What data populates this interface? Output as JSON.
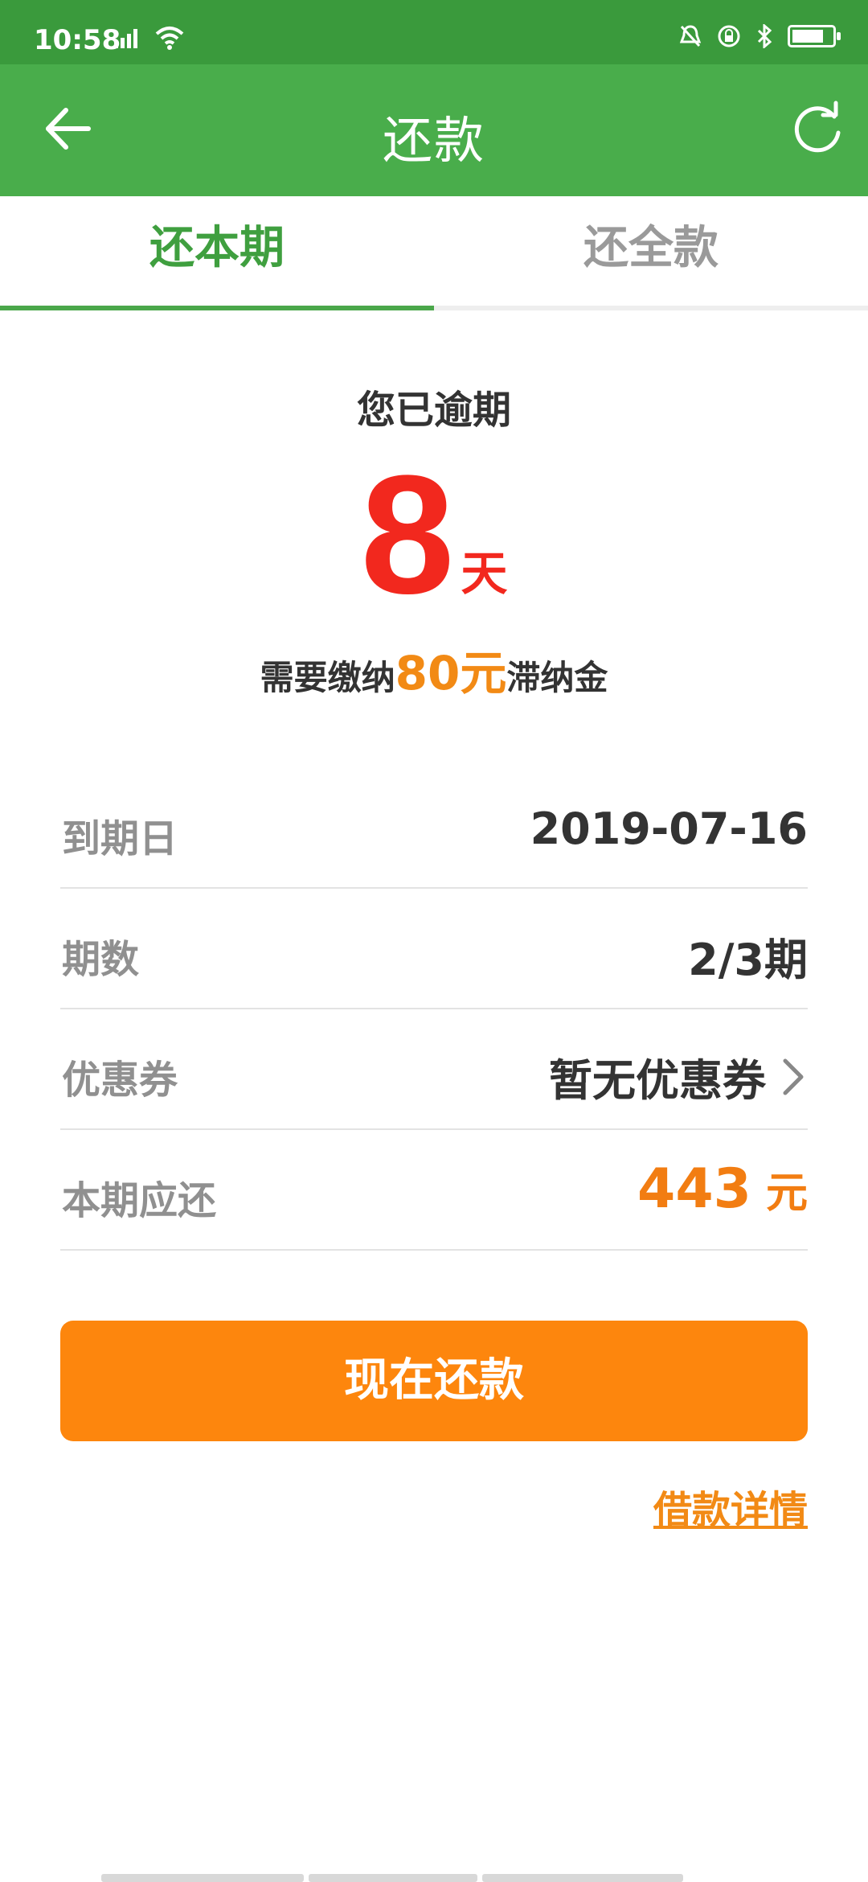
{
  "status_bar": {
    "time": "10:58",
    "signal_icon": "signal-icon",
    "wifi_icon": "wifi-icon",
    "alarm_off_icon": "alarm-off-icon",
    "lock_icon": "lock-icon",
    "bluetooth_icon": "bluetooth-icon",
    "battery_icon": "battery-icon"
  },
  "header": {
    "title": "还款",
    "back_icon": "back-arrow-icon",
    "refresh_icon": "refresh-icon",
    "bg_color": "#49ad4b"
  },
  "tabs": [
    {
      "label": "还本期",
      "active": true
    },
    {
      "label": "还全款",
      "active": false
    }
  ],
  "overdue": {
    "label": "您已逾期",
    "days": "8",
    "days_unit": "天",
    "fee_prefix": "需要缴纳",
    "fee_amount": "80元",
    "fee_suffix": "滞纳金",
    "days_color": "#f2281e",
    "fee_color": "#f28a15"
  },
  "details": {
    "due_date_label": "到期日",
    "due_date_value": "2019-07-16",
    "period_label": "期数",
    "period_value": "2/3期",
    "coupon_label": "优惠券",
    "coupon_value": "暂无优惠券",
    "amount_label": "本期应还",
    "amount_value": "443",
    "amount_unit": "元"
  },
  "actions": {
    "pay_button": "现在还款",
    "detail_link": "借款详情",
    "button_color": "#fd860d"
  }
}
